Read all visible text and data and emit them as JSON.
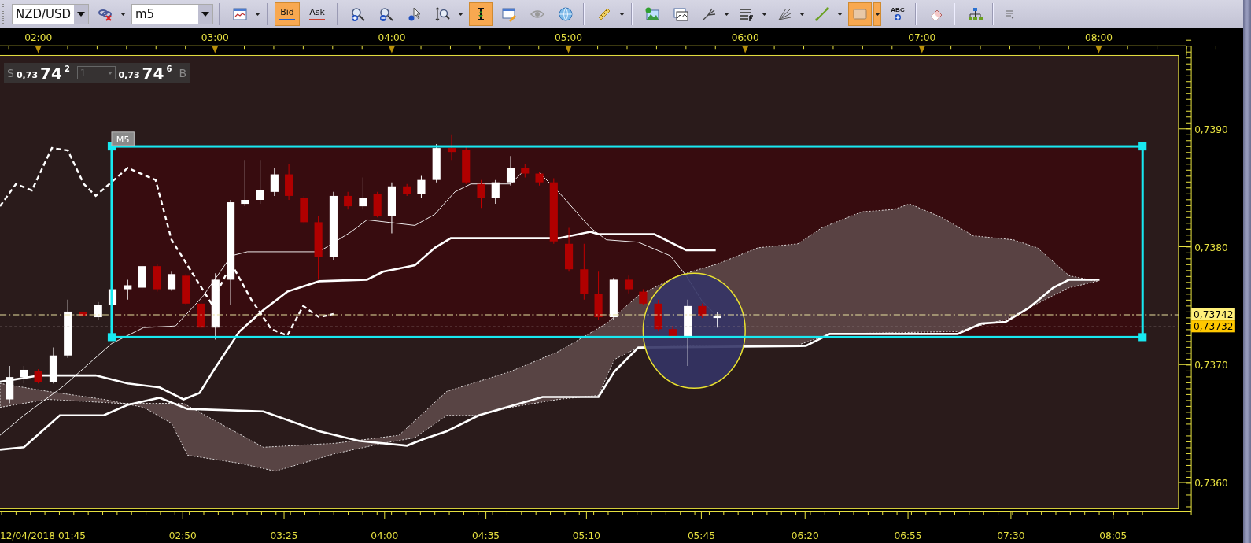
{
  "toolbar": {
    "symbol": "NZD/USD",
    "timeframe": "m5",
    "price_buttons": [
      {
        "label": "Bid",
        "selected": true,
        "color": "#1f5fcf"
      },
      {
        "label": "Ask",
        "selected": false,
        "color": "#d04030"
      }
    ],
    "tools": [
      {
        "selected": false
      },
      {
        "selected": false
      },
      {
        "selected": false
      },
      {
        "selected": false
      },
      {
        "selected": false
      },
      {
        "selected": false
      },
      {
        "selected": true
      },
      {
        "selected": false
      },
      {
        "selected": false
      },
      {
        "selected": false
      },
      {
        "selected": false
      },
      {
        "selected": false
      },
      {
        "selected": false
      },
      {
        "selected": false
      },
      {
        "selected": false
      },
      {
        "selected": false
      },
      {
        "selected": false
      },
      {
        "selected": true
      },
      {
        "selected": false,
        "label": "ABC"
      },
      {
        "selected": false
      },
      {
        "selected": false
      }
    ]
  },
  "quote": {
    "sell_label": "S",
    "sell_prefix": "0,73",
    "sell_pips": "74",
    "sell_fraction": "2",
    "lot": "1",
    "buy_prefix": "0,73",
    "buy_pips": "74",
    "buy_fraction": "6",
    "buy_label": "B"
  },
  "chart": {
    "drawing_label": "M5",
    "time_axis_top": [
      "02:00",
      "03:00",
      "04:00",
      "05:00",
      "06:00",
      "07:00",
      "08:00"
    ],
    "price_axis": [
      "0,7390",
      "0,7380",
      "0,7370",
      "0,7360"
    ],
    "price_markers": [
      {
        "label": "0,73742"
      },
      {
        "label": "0,73732"
      }
    ],
    "time_axis_bottom": [
      "12/04/2018 01:45",
      "02:50",
      "03:25",
      "04:00",
      "04:35",
      "05:10",
      "05:45",
      "06:20",
      "06:55",
      "07:30",
      "08:05"
    ]
  }
}
